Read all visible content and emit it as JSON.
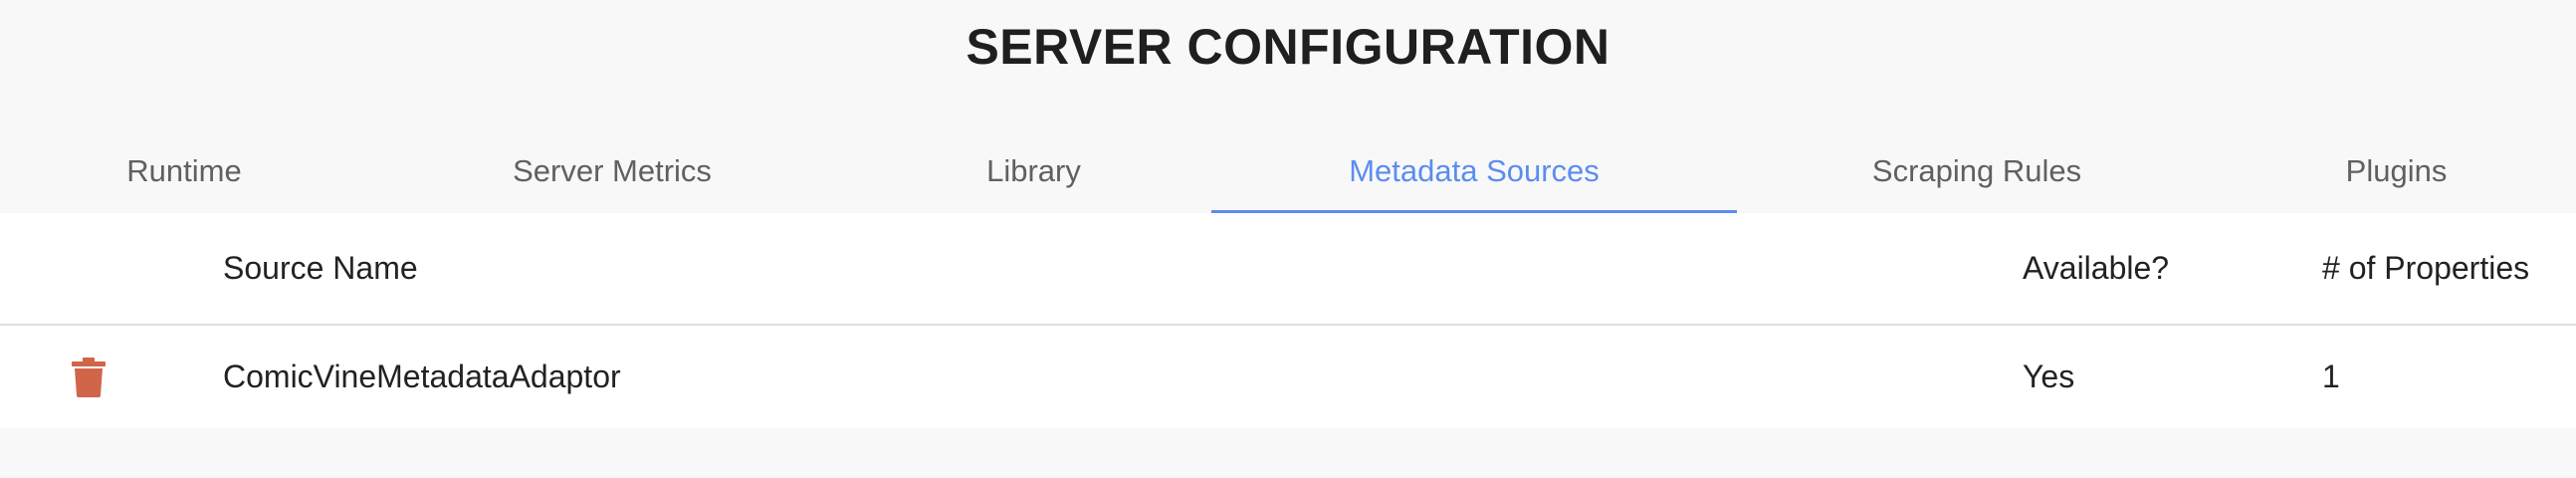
{
  "header": {
    "title": "SERVER CONFIGURATION"
  },
  "tabs": [
    {
      "label": "Runtime"
    },
    {
      "label": "Server Metrics"
    },
    {
      "label": "Library"
    },
    {
      "label": "Metadata Sources",
      "active": true
    },
    {
      "label": "Scraping Rules"
    },
    {
      "label": "Plugins"
    }
  ],
  "table": {
    "columns": {
      "name": "Source Name",
      "available": "Available?",
      "properties": "# of Properties"
    },
    "rows": [
      {
        "name": "ComicVineMetadataAdaptor",
        "available": "Yes",
        "properties": "1",
        "action_icon": "trash-icon"
      }
    ]
  },
  "colors": {
    "accent": "#5b8def",
    "delete": "#d0654a",
    "background": "#f8f8f8"
  }
}
